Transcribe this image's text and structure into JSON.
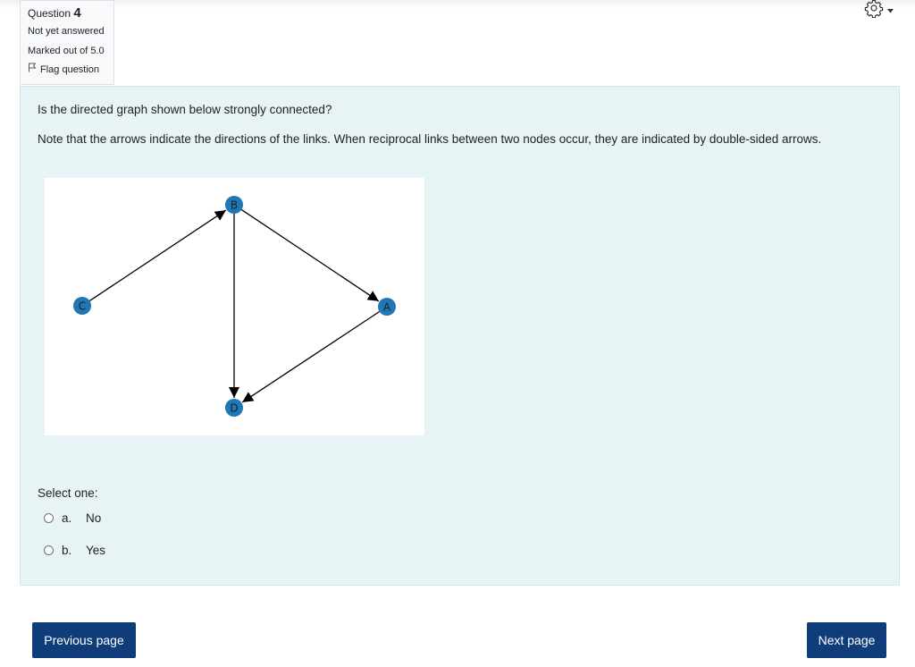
{
  "question_info": {
    "label": "Question",
    "number": "4",
    "status": "Not yet answered",
    "marks": "Marked out of 5.0",
    "flag_label": "Flag question"
  },
  "question": {
    "text": "Is the directed graph shown below strongly connected?",
    "note": "Note that the arrows indicate the directions of the links. When reciprocal links between two nodes occur, they are indicated by double-sided arrows."
  },
  "graph": {
    "nodes": [
      "B",
      "C",
      "A",
      "D"
    ],
    "edges": [
      {
        "from": "C",
        "to": "B"
      },
      {
        "from": "B",
        "to": "A"
      },
      {
        "from": "B",
        "to": "D"
      },
      {
        "from": "A",
        "to": "D"
      }
    ],
    "node_color": "#1f77b4"
  },
  "answer": {
    "prompt": "Select one:",
    "options": [
      {
        "letter": "a.",
        "label": "No"
      },
      {
        "letter": "b.",
        "label": "Yes"
      }
    ]
  },
  "nav": {
    "previous_label": "Previous page",
    "next_label": "Next page"
  },
  "colors": {
    "button": "#0f3d7a",
    "content_bg": "#e7f3f5"
  }
}
